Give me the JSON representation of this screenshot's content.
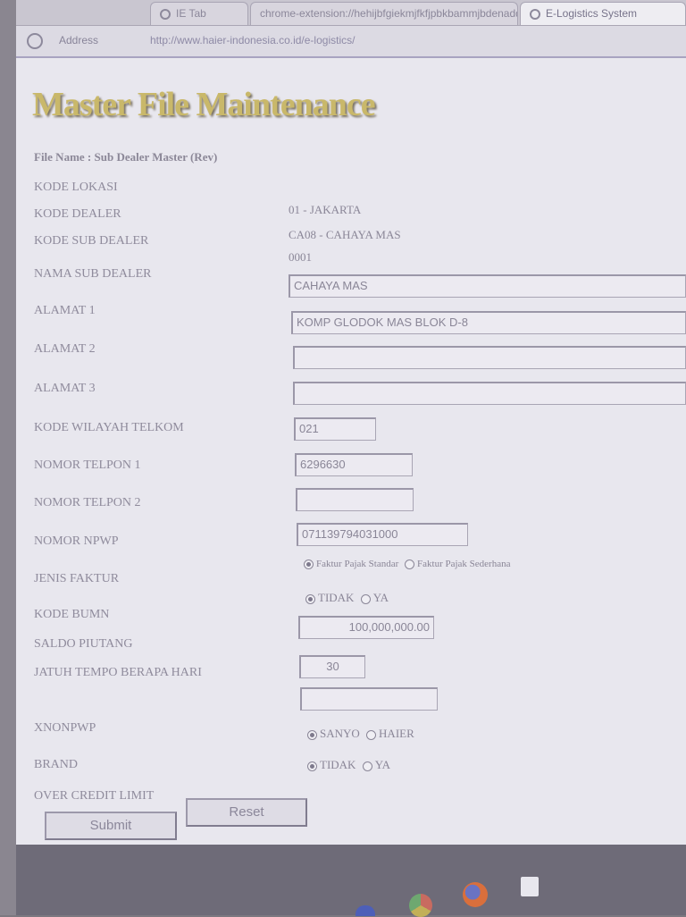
{
  "browser": {
    "tabs": [
      {
        "label": "IE Tab"
      },
      {
        "label": "chrome-extension://hehijbfgiekmjfkfjpbkbammjbdenadd/nhc"
      },
      {
        "label": "E-Logistics System"
      }
    ],
    "address_label": "Address",
    "address_url": "http://www.haier-indonesia.co.id/e-logistics/"
  },
  "page": {
    "title": "Master File Maintenance",
    "file_name": "File Name : Sub Dealer Master (Rev)"
  },
  "fields": {
    "kode_lokasi": {
      "label": "KODE LOKASI",
      "value": "01 - JAKARTA"
    },
    "kode_dealer": {
      "label": "KODE DEALER",
      "value": "CA08 - CAHAYA MAS"
    },
    "kode_sub_dealer": {
      "label": "KODE SUB DEALER",
      "value": "0001"
    },
    "nama_sub_dealer": {
      "label": "NAMA SUB DEALER",
      "value": "CAHAYA MAS"
    },
    "alamat1": {
      "label": "ALAMAT 1",
      "value": "KOMP GLODOK MAS BLOK D-8"
    },
    "alamat2": {
      "label": "ALAMAT 2",
      "value": ""
    },
    "alamat3": {
      "label": "ALAMAT 3",
      "value": ""
    },
    "kode_wilayah": {
      "label": "KODE WILAYAH TELKOM",
      "value": "021"
    },
    "telpon1": {
      "label": "NOMOR TELPON 1",
      "value": "6296630"
    },
    "telpon2": {
      "label": "NOMOR TELPON 2",
      "value": ""
    },
    "npwp": {
      "label": "NOMOR NPWP",
      "value": "071139794031000"
    },
    "jenis_faktur": {
      "label": "JENIS FAKTUR",
      "options": [
        "Faktur Pajak Standar",
        "Faktur Pajak Sederhana"
      ],
      "selected": "Faktur Pajak Standar"
    },
    "kode_bumn": {
      "label": "KODE BUMN",
      "options": [
        "TIDAK",
        "YA"
      ],
      "selected": "TIDAK"
    },
    "saldo_piutang": {
      "label": "SALDO PIUTANG",
      "value": "100,000,000.00"
    },
    "jatuh_tempo": {
      "label": "JATUH TEMPO BERAPA HARI",
      "value": "30"
    },
    "xnonpwp": {
      "label": "XNONPWP",
      "value": ""
    },
    "brand": {
      "label": "BRAND",
      "options": [
        "SANYO",
        "HAIER"
      ],
      "selected": "SANYO"
    },
    "over_credit": {
      "label": "OVER CREDIT LIMIT",
      "options": [
        "TIDAK",
        "YA"
      ],
      "selected": "TIDAK"
    }
  },
  "buttons": {
    "submit": "Submit",
    "reset": "Reset"
  }
}
